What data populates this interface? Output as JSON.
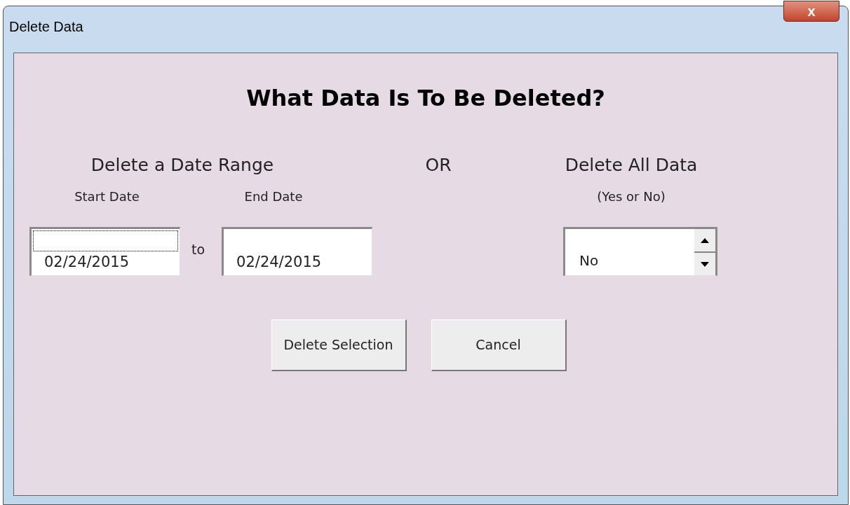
{
  "window": {
    "title": "Delete Data",
    "close_label": "x"
  },
  "heading": "What Data Is To Be Deleted?",
  "range": {
    "label": "Delete a Date Range",
    "start_label": "Start Date",
    "end_label": "End Date",
    "separator": "to",
    "start": {
      "value": "02/24/2015",
      "focused": true
    },
    "end": {
      "value": "02/24/2015",
      "focused": false
    }
  },
  "or_label": "OR",
  "all": {
    "label": "Delete All Data",
    "hint": "(Yes or No)",
    "value": "No"
  },
  "buttons": [
    "Delete Selection",
    "Cancel"
  ]
}
